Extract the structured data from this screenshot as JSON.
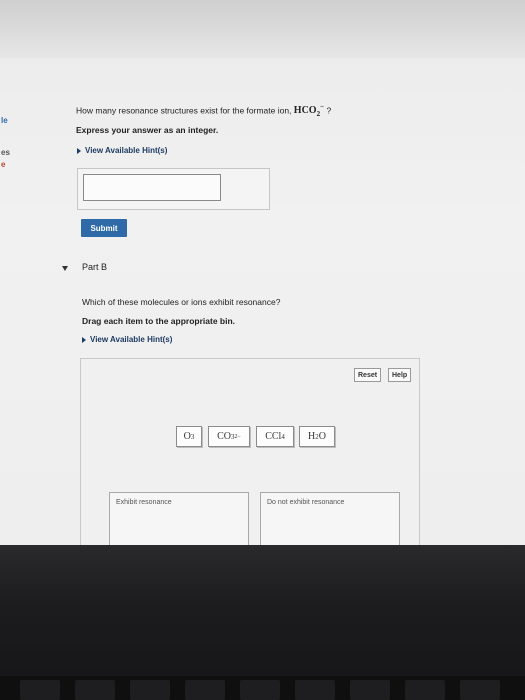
{
  "question": {
    "prefix": "How many resonance structures exist for the formate ion, ",
    "formula_base": "HCO",
    "formula_sub": "2",
    "formula_sup": "−",
    "suffix": " ?",
    "instruction": "Express your answer as an integer.",
    "hint_label": "View Available Hint(s)",
    "answer_value": "",
    "submit_label": "Submit"
  },
  "left_edge": {
    "items": [
      "le",
      "es",
      "e"
    ]
  },
  "part_b": {
    "title": "Part B",
    "question": "Which of these molecules or ions exhibit resonance?",
    "instruction": "Drag each item to the appropriate bin.",
    "hint_label": "View Available Hint(s)",
    "reset_label": "Reset",
    "help_label": "Help",
    "chips": [
      {
        "base": "O",
        "sub": "3",
        "sup": ""
      },
      {
        "base": "CO",
        "sub": "3",
        "sup": "2−"
      },
      {
        "base": "CCl",
        "sub": "4",
        "sup": ""
      },
      {
        "base": "H",
        "sub": "2",
        "sup": "",
        "tail": "O"
      }
    ],
    "bins": [
      "Exhibit resonance",
      "Do not exhibit resonance"
    ]
  },
  "colors": {
    "submit": "#2f6aa8",
    "hint_link": "#1d3b63",
    "left_edge_accent": "#2f6aa8",
    "left_edge_warn": "#b5462b"
  }
}
